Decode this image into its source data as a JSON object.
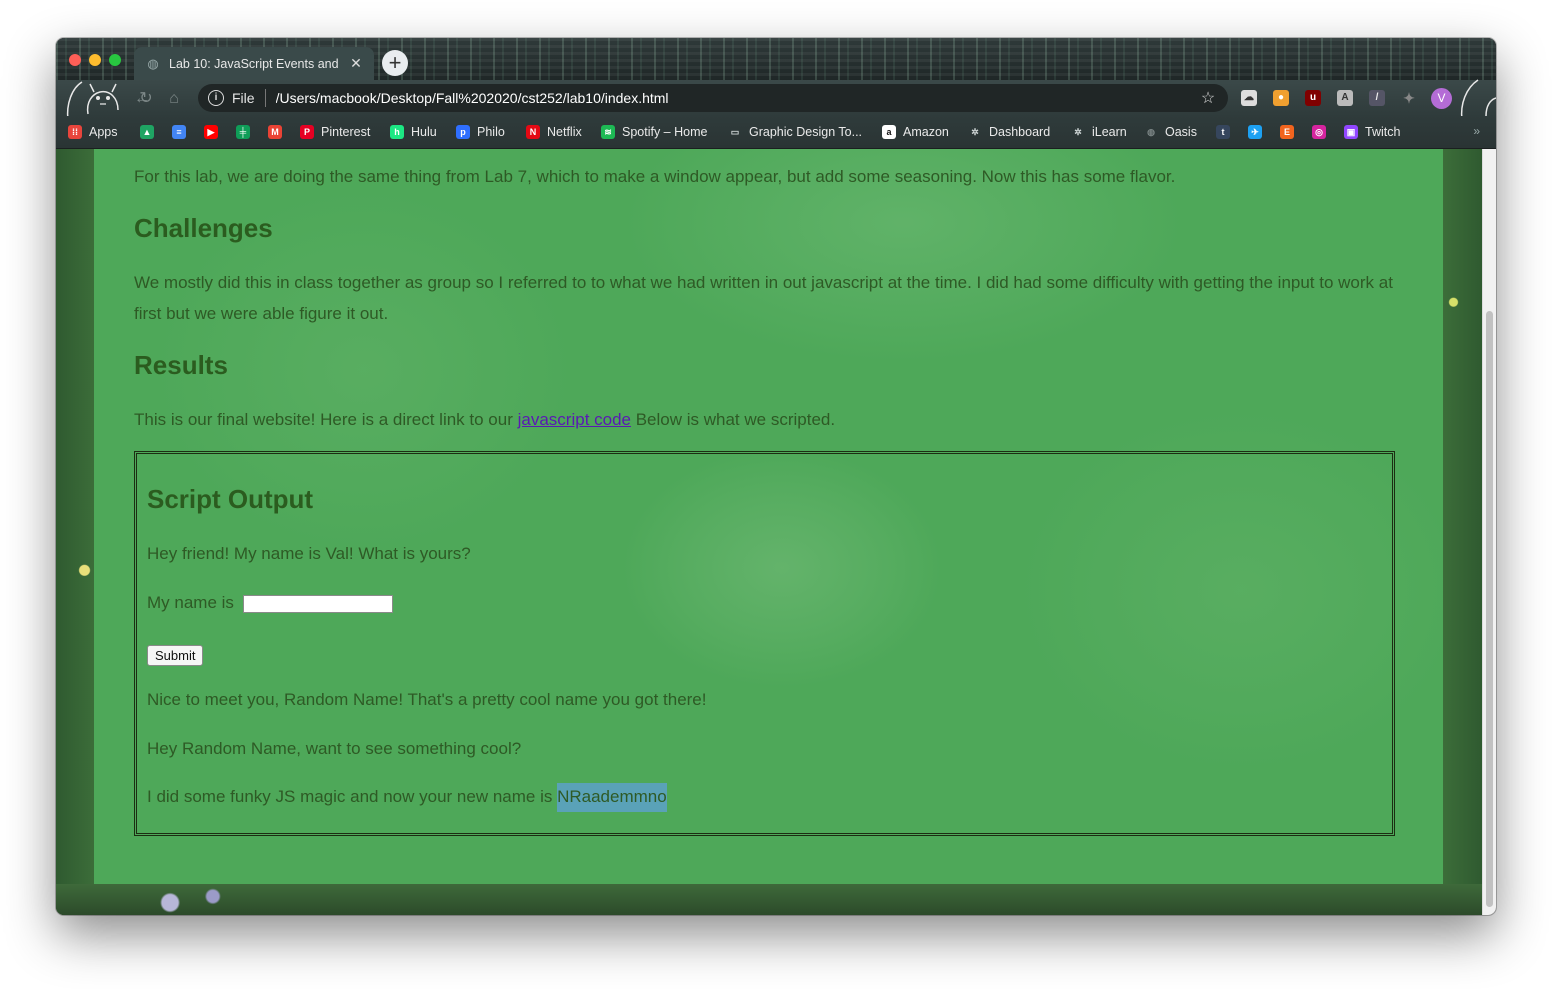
{
  "browser": {
    "tab_title": "Lab 10: JavaScript Events and",
    "address_scheme": "File",
    "url": "/Users/macbook/Desktop/Fall%202020/cst252/lab10/index.html",
    "profile_initial": "V",
    "bookmarks": [
      {
        "label": "Apps",
        "icon": "apps-grid-icon",
        "color": "#e8453c"
      },
      {
        "label": "",
        "icon": "google-drive-icon",
        "color": "#1fa463"
      },
      {
        "label": "",
        "icon": "google-docs-icon",
        "color": "#4285f4"
      },
      {
        "label": "",
        "icon": "youtube-icon",
        "color": "#ff0000"
      },
      {
        "label": "",
        "icon": "google-sheets-icon",
        "color": "#0f9d58"
      },
      {
        "label": "",
        "icon": "gmail-icon",
        "color": "#ea4335"
      },
      {
        "label": "Pinterest",
        "icon": "pinterest-icon",
        "color": "#e60023"
      },
      {
        "label": "Hulu",
        "icon": "hulu-icon",
        "color": "#1ce783"
      },
      {
        "label": "Philo",
        "icon": "philo-icon",
        "color": "#2f6fff"
      },
      {
        "label": "Netflix",
        "icon": "netflix-icon",
        "color": "#e50914"
      },
      {
        "label": "Spotify – Home",
        "icon": "spotify-icon",
        "color": "#1db954"
      },
      {
        "label": "Graphic Design To...",
        "icon": "folder-icon",
        "color": "#cfd6d6"
      },
      {
        "label": "Amazon",
        "icon": "amazon-icon",
        "color": "#ffffff"
      },
      {
        "label": "Dashboard",
        "icon": "canvas-icon",
        "color": "#cfd6d6"
      },
      {
        "label": "iLearn",
        "icon": "canvas-icon",
        "color": "#cfd6d6"
      },
      {
        "label": "Oasis",
        "icon": "globe-icon",
        "color": "#7b8585"
      },
      {
        "label": "",
        "icon": "tumblr-icon",
        "color": "#36465d"
      },
      {
        "label": "",
        "icon": "twitter-icon",
        "color": "#1da1f2"
      },
      {
        "label": "",
        "icon": "etsy-icon",
        "color": "#f1641e"
      },
      {
        "label": "",
        "icon": "instagram-icon",
        "color": "#d6249f"
      },
      {
        "label": "Twitch",
        "icon": "twitch-icon",
        "color": "#9146ff"
      }
    ]
  },
  "content": {
    "intro": "For this lab, we are doing the same thing from Lab 7, which to make a window appear, but add some seasoning. Now this has some flavor.",
    "challenges_heading": "Challenges",
    "challenges_text": "We mostly did this in class together as group so I referred to to what we had written in out javascript at the time. I did had some difficulty with getting the input to work at first but we were able figure it out.",
    "results_heading": "Results",
    "results_before": "This is our final website! Here is a direct link to our ",
    "results_link": "javascript code",
    "results_after": " Below is what we scripted.",
    "script_output": {
      "heading": "Script Output",
      "greeting": "Hey friend! My name is Val! What is yours?",
      "name_label": "My name is",
      "name_value": "",
      "submit_label": "Submit",
      "reply_1": "Nice to meet you, Random Name! That's a pretty cool name you got there!",
      "reply_2": "Hey Random Name, want to see something cool?",
      "reply_3_prefix": "I did some funky JS magic and now your new name is ",
      "scrambled_name": "NRaademmno"
    }
  },
  "colors": {
    "page_bg": "#4ea859",
    "text": "#2e5a25",
    "link": "#5a1ab3",
    "highlight": "#5aa2b8"
  }
}
